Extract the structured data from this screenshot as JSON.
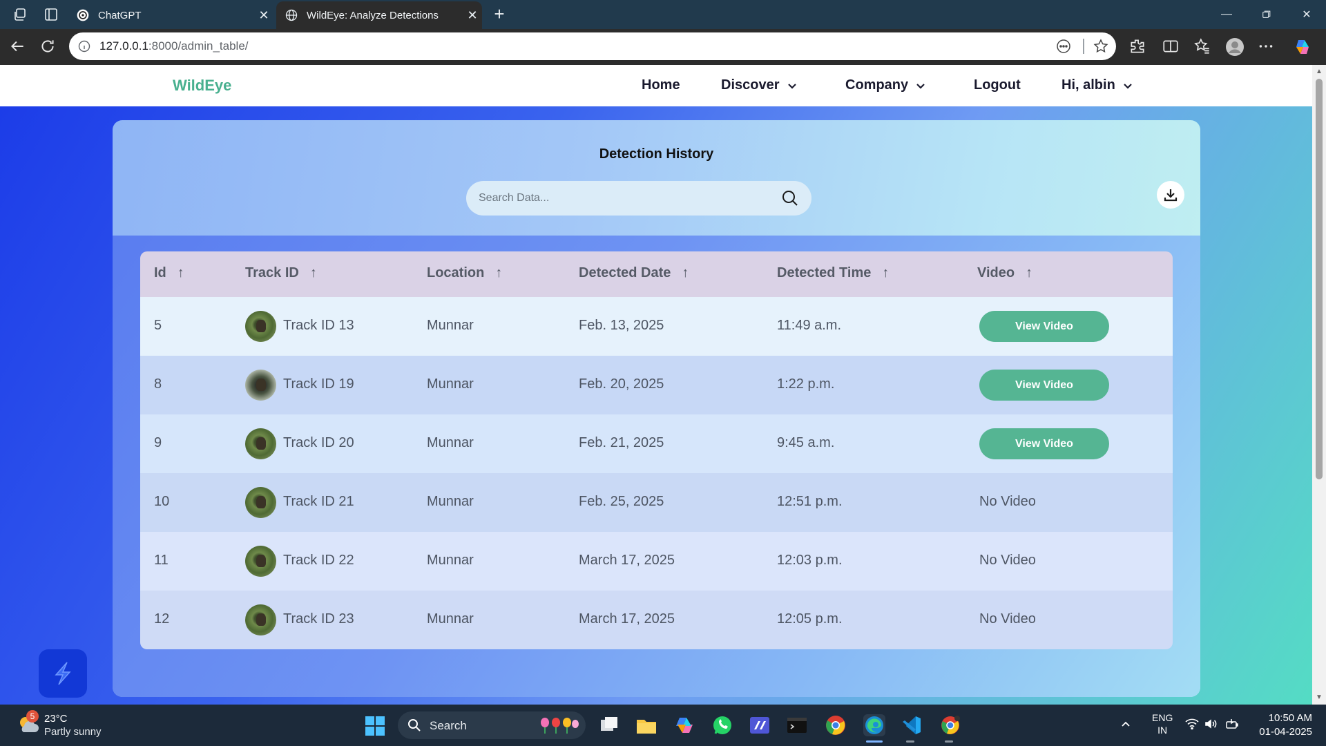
{
  "browser": {
    "tabs": [
      {
        "title": "ChatGPT",
        "active": false
      },
      {
        "title": "WildEye: Analyze Detections",
        "active": true
      }
    ],
    "url_host": "127.0.0.1",
    "url_rest": ":8000/admin_table/"
  },
  "site": {
    "brand": "WildEye",
    "nav": {
      "home": "Home",
      "discover": "Discover",
      "company": "Company",
      "logout": "Logout",
      "user": "Hi, albin"
    },
    "brand_color": "#48b08f"
  },
  "card": {
    "title": "Detection History",
    "search_placeholder": "Search Data...",
    "sort_arrow": "↑"
  },
  "table": {
    "headers": [
      "Id",
      "Track ID",
      "Location",
      "Detected Date",
      "Detected Time",
      "Video"
    ],
    "rows": [
      {
        "id": "5",
        "track": "Track ID 13",
        "location": "Munnar",
        "date": "Feb. 13, 2025",
        "time": "11:49 a.m.",
        "video": "View Video"
      },
      {
        "id": "8",
        "track": "Track ID 19",
        "location": "Munnar",
        "date": "Feb. 20, 2025",
        "time": "1:22 p.m.",
        "video": "View Video"
      },
      {
        "id": "9",
        "track": "Track ID 20",
        "location": "Munnar",
        "date": "Feb. 21, 2025",
        "time": "9:45 a.m.",
        "video": "View Video"
      },
      {
        "id": "10",
        "track": "Track ID 21",
        "location": "Munnar",
        "date": "Feb. 25, 2025",
        "time": "12:51 p.m.",
        "video": "No Video"
      },
      {
        "id": "11",
        "track": "Track ID 22",
        "location": "Munnar",
        "date": "March 17, 2025",
        "time": "12:03 p.m.",
        "video": "No Video"
      },
      {
        "id": "12",
        "track": "Track ID 23",
        "location": "Munnar",
        "date": "March 17, 2025",
        "time": "12:05 p.m.",
        "video": "No Video"
      }
    ],
    "button_color": "#55b593"
  },
  "taskbar": {
    "weather_badge": "5",
    "temperature": "23°C",
    "weather": "Partly sunny",
    "search": "Search",
    "lang_1": "ENG",
    "lang_2": "IN",
    "time": "10:50 AM",
    "date": "01-04-2025"
  }
}
